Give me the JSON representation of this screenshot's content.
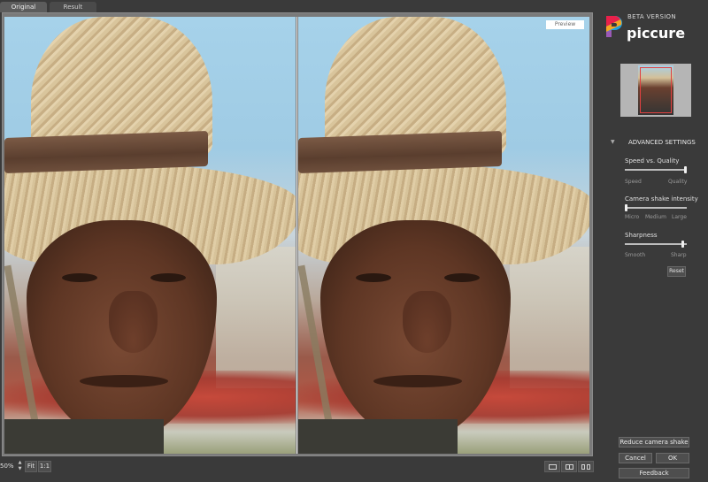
{
  "tabs": [
    {
      "label": "Original",
      "active": true
    },
    {
      "label": "Result",
      "active": false
    }
  ],
  "preview": {
    "badge": "Preview"
  },
  "toolbar": {
    "zoom": "50%",
    "fit_label": "Fit",
    "one_to_one_label": "1:1",
    "view_modes": [
      "single-view-icon",
      "split-view-icon",
      "side-by-side-icon"
    ]
  },
  "brand": {
    "beta": "BETA VERSION",
    "name": "piccure"
  },
  "advanced": {
    "title": "ADVANCED SETTINGS",
    "settings": [
      {
        "label": "Speed vs. Quality",
        "ticks": [
          "Speed",
          "Quality"
        ],
        "value": 1.0
      },
      {
        "label": "Camera shake intensity",
        "ticks": [
          "Micro",
          "Medium",
          "Large"
        ],
        "value": 0.0
      },
      {
        "label": "Sharpness",
        "ticks": [
          "Smooth",
          "Sharp"
        ],
        "value": 0.95
      }
    ],
    "reset_label": "Reset"
  },
  "actions": {
    "reduce_label": "Reduce camera shake",
    "cancel_label": "Cancel",
    "ok_label": "OK",
    "feedback_label": "Feedback"
  },
  "colors": {
    "background": "#3a3a3a",
    "accent_logo": [
      "#e8204a",
      "#f5a623",
      "#1ea1e0",
      "#7bc043",
      "#9b59b6"
    ]
  }
}
